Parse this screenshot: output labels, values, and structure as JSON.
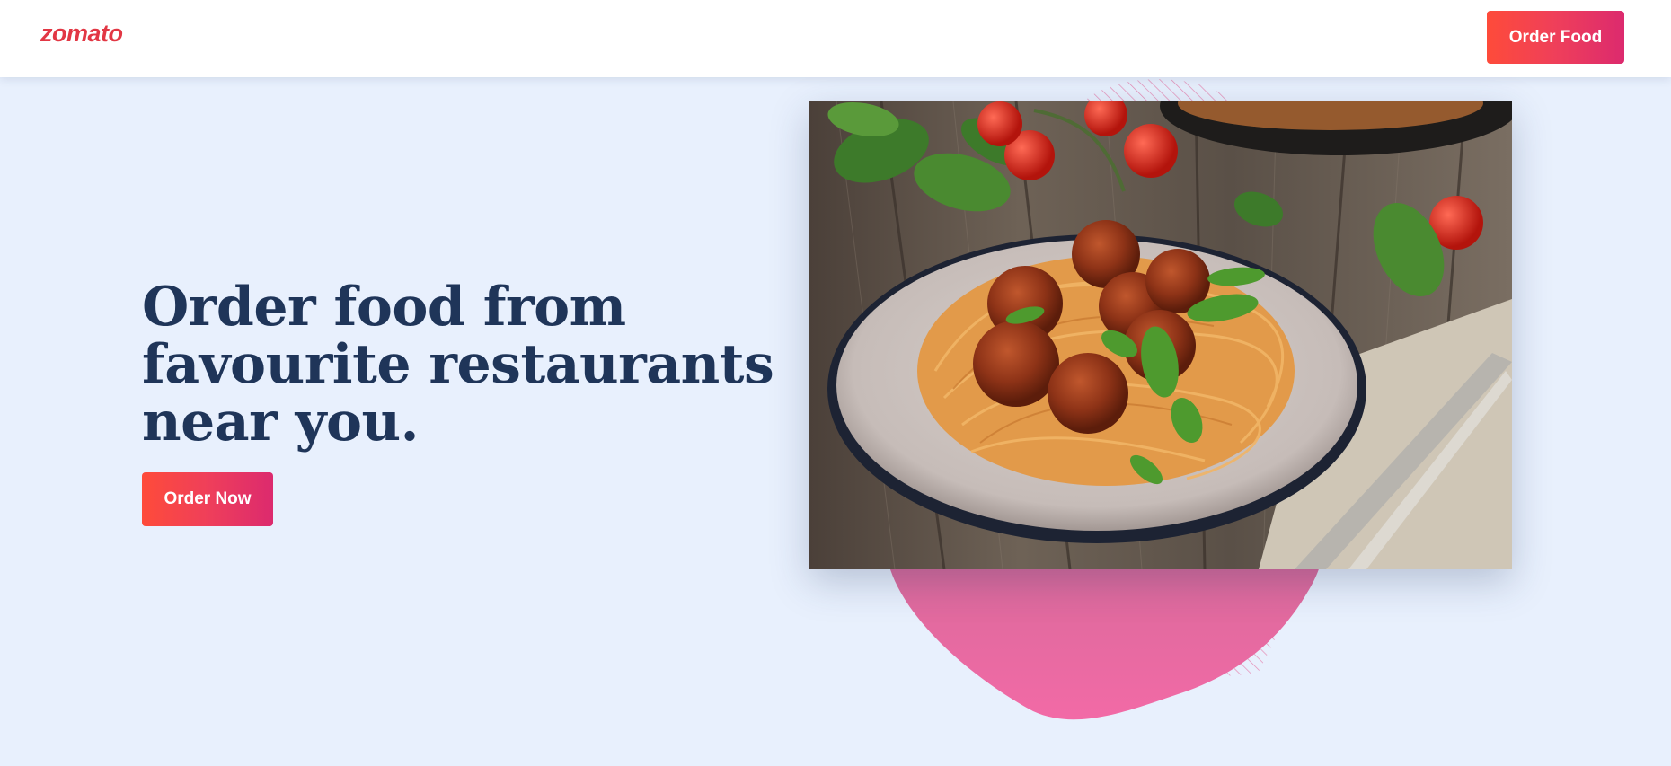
{
  "header": {
    "logo_text": "zomato",
    "order_food_label": "Order Food"
  },
  "hero": {
    "title_lines": [
      "Order food from",
      "favourite restaurants",
      "near you."
    ],
    "order_now_label": "Order Now",
    "image_subject": "plate of spaghetti with meatballs on a wooden table"
  },
  "colors": {
    "brand_red": "#e23744",
    "button_gradient_start": "#fe4b3a",
    "button_gradient_end": "#dc2a6e",
    "heading": "#1f3559",
    "background": "#e8f0fd",
    "blob_pink": "#ef67a2"
  }
}
